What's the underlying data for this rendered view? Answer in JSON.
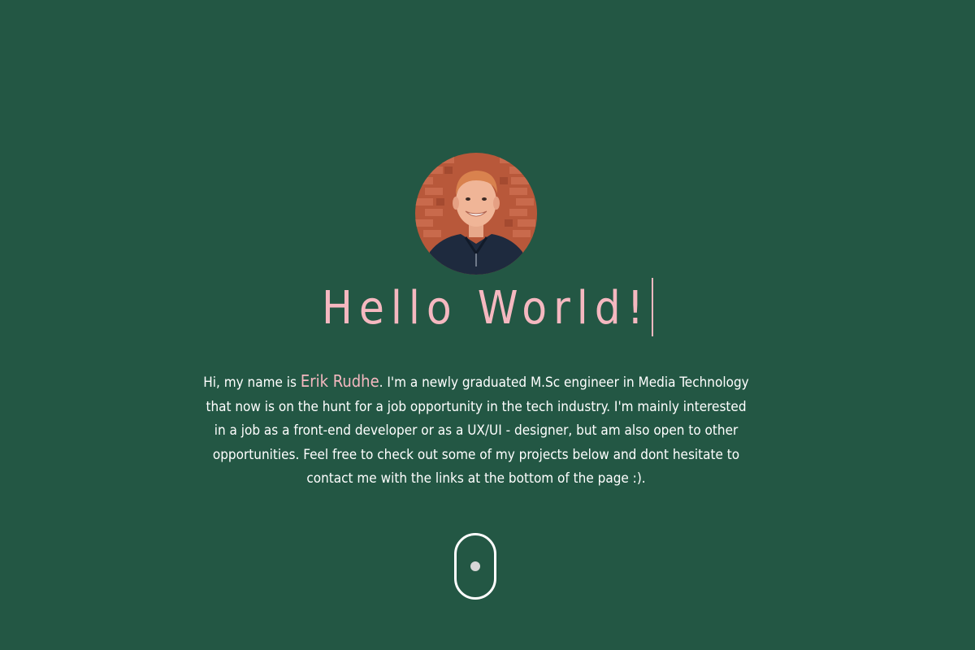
{
  "hero": {
    "headline": "Hello World!",
    "intro": {
      "before_name": "Hi, my name is ",
      "name": "Erik Rudhe",
      "after_name": ". I'm a newly graduated M.Sc engineer in Media Technology that now is on the hunt for a job opportunity in the tech industry. I'm mainly interested in a job as a front-end developer or as a UX/UI - designer, but am also open to other opportunities. Feel free to check out some of my projects below and dont hesitate to contact me with the links at the bottom of the page :)."
    },
    "scroll_indicator": {
      "icon": "mouse-scroll-icon"
    }
  },
  "colors": {
    "background": "#235744",
    "accent": "#f5b8c0",
    "text": "#ffffff"
  }
}
